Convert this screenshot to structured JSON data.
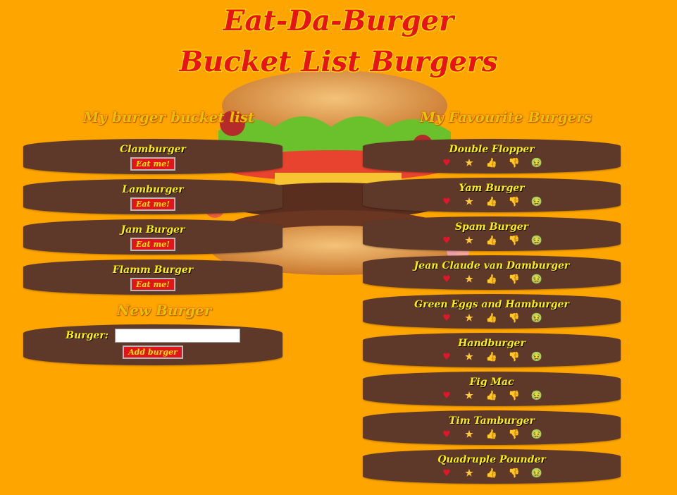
{
  "header": {
    "title": "Eat-Da-Burger",
    "subtitle": "Bucket List Burgers"
  },
  "bucket": {
    "heading": "My burger bucket list",
    "eat_label": "Eat me!",
    "items": [
      {
        "name": "Clamburger"
      },
      {
        "name": "Lamburger"
      },
      {
        "name": "Jam Burger"
      },
      {
        "name": "Flamm Burger"
      }
    ]
  },
  "new_burger": {
    "heading": "New Burger",
    "label": "Burger:",
    "value": "",
    "button": "Add burger"
  },
  "favourites": {
    "heading": "My Favourite Burgers",
    "icons": [
      "heart-icon",
      "star-icon",
      "thumbs-up-icon",
      "thumbs-down-icon",
      "sick-face-icon"
    ],
    "items": [
      {
        "name": "Double Flopper"
      },
      {
        "name": "Yam Burger"
      },
      {
        "name": "Spam Burger"
      },
      {
        "name": "Jean Claude van Damburger"
      },
      {
        "name": "Green Eggs and Hamburger"
      },
      {
        "name": "Handburger"
      },
      {
        "name": "Fig Mac"
      },
      {
        "name": "Tim Tamburger"
      },
      {
        "name": "Quadruple Pounder"
      }
    ]
  },
  "colors": {
    "background": "#FFA500",
    "card": "#5E3829",
    "text": "#FFF000",
    "button": "#E0151A",
    "title": "#E8121B"
  }
}
